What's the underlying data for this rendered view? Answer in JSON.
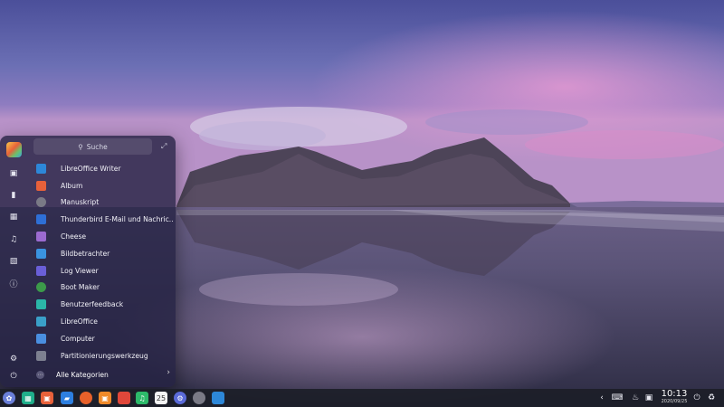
{
  "launcher": {
    "search_placeholder": "Suche",
    "apps": [
      {
        "label": "LibreOffice Writer",
        "icon": "writer-icon",
        "color": "#2d87d8"
      },
      {
        "label": "Album",
        "icon": "album-icon",
        "color": "#e8613a"
      },
      {
        "label": "Manuskript",
        "icon": "manuskript-icon",
        "color": "#7a7a86"
      },
      {
        "label": "Thunderbird E-Mail und Nachric...",
        "icon": "thunderbird-icon",
        "color": "#2e6fd6"
      },
      {
        "label": "Cheese",
        "icon": "cheese-icon",
        "color": "#9b6bd0"
      },
      {
        "label": "Bildbetrachter",
        "icon": "image-viewer-icon",
        "color": "#3a93e0"
      },
      {
        "label": "Log Viewer",
        "icon": "log-viewer-icon",
        "color": "#6a5fd8"
      },
      {
        "label": "Boot Maker",
        "icon": "boot-maker-icon",
        "color": "#3c9a4a"
      },
      {
        "label": "Benutzerfeedback",
        "icon": "feedback-icon",
        "color": "#2bb7a8"
      },
      {
        "label": "LibreOffice",
        "icon": "libreoffice-icon",
        "color": "#3aa0c8"
      },
      {
        "label": "Computer",
        "icon": "computer-icon",
        "color": "#4a8fe0"
      },
      {
        "label": "Partitionierungswerkzeug",
        "icon": "partition-icon",
        "color": "#7d8090"
      }
    ],
    "all_categories": "Alle Kategorien"
  },
  "taskbar": {
    "time": "10:13",
    "date": "2020/09/25"
  },
  "colors": {
    "launcher_bg": "#242242",
    "taskbar_bg": "#1c1e28"
  }
}
